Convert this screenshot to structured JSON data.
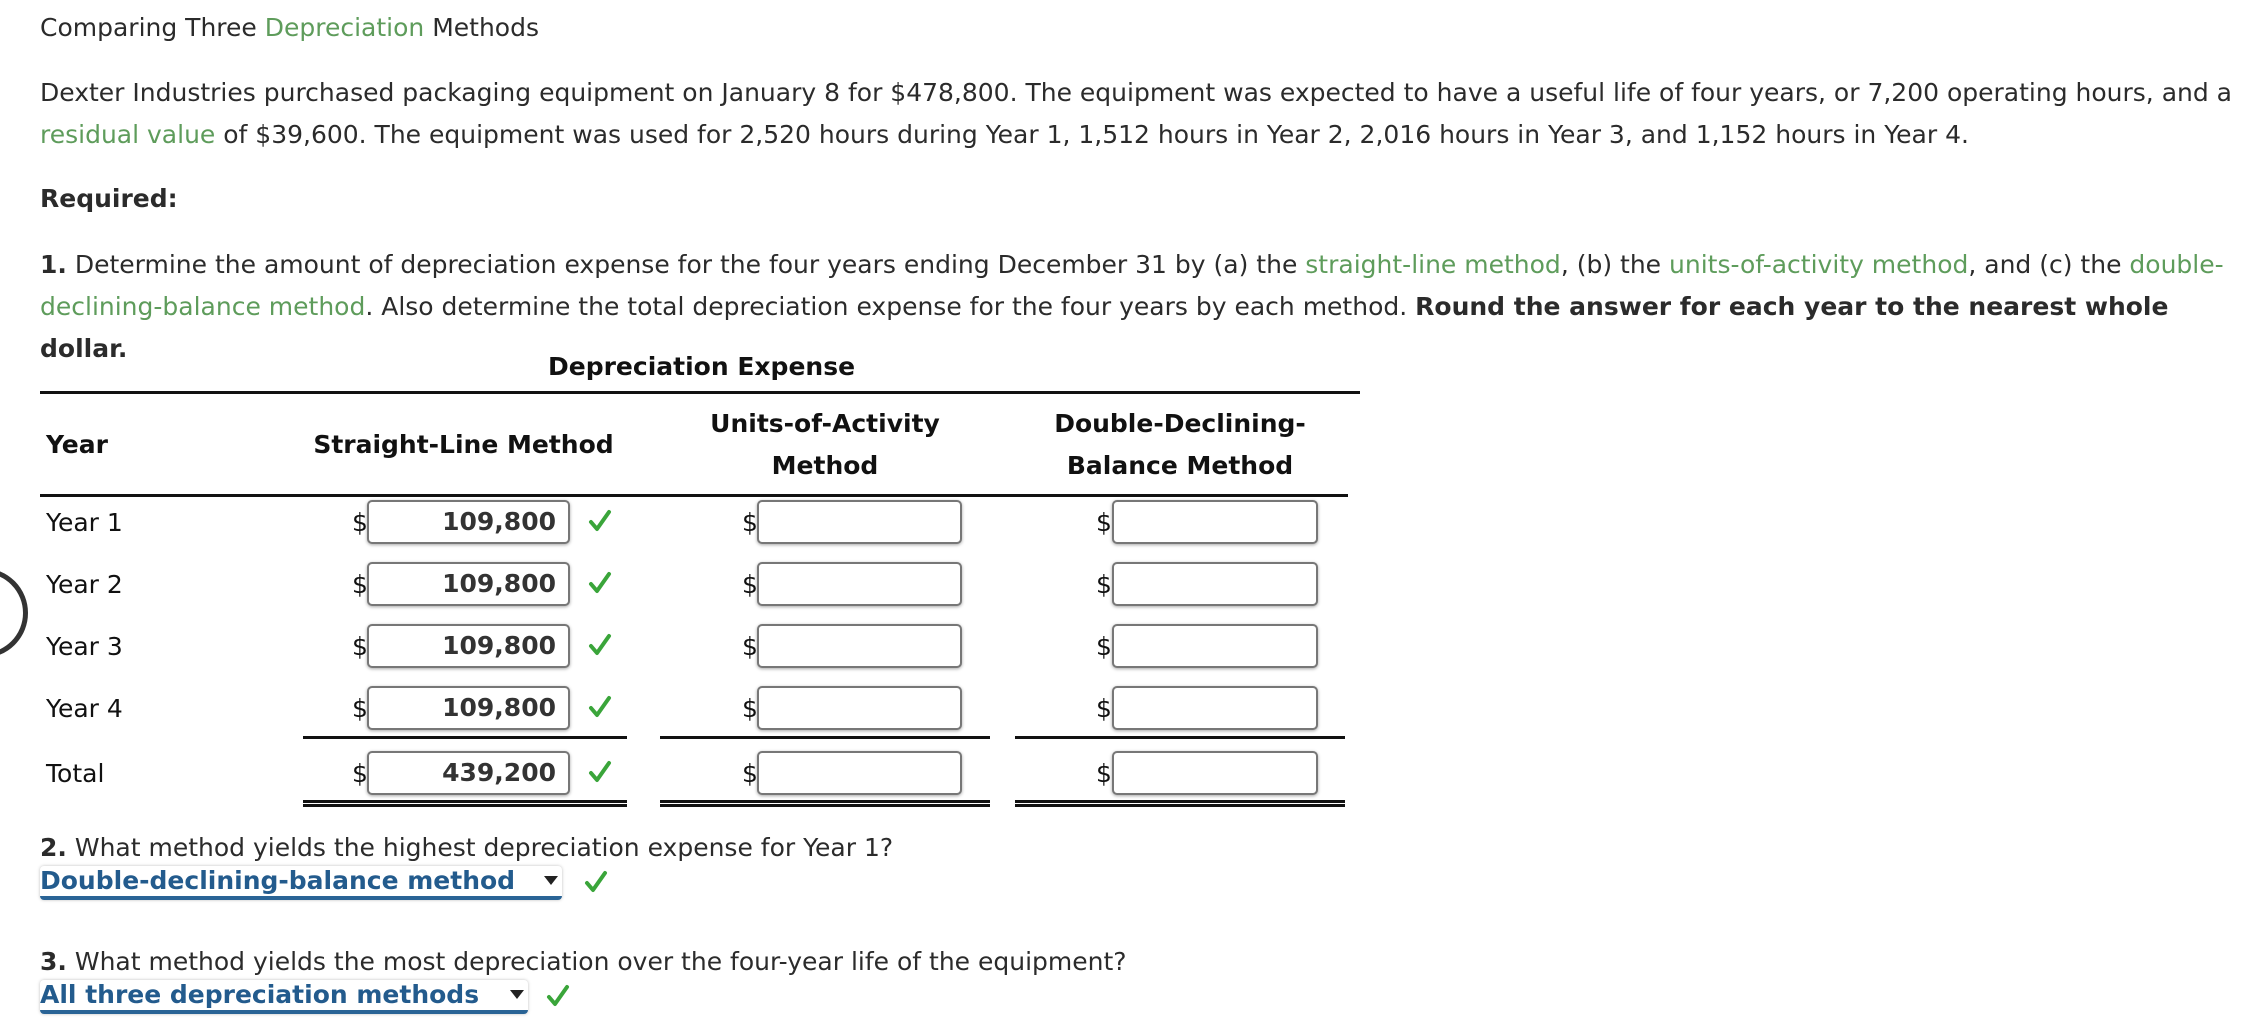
{
  "title": {
    "prefix": "Comparing Three ",
    "link": "Depreciation",
    "suffix": " Methods"
  },
  "problem": {
    "text_before": "Dexter Industries purchased packaging equipment on January 8 for $478,800. The equipment was expected to have a useful life of four years, or 7,200 operating hours, and a ",
    "link": "residual value",
    "text_after": " of $39,600. The equipment was used for 2,520 hours during Year 1, 1,512 hours in Year 2, 2,016 hours in Year 3, and 1,152 hours in Year 4."
  },
  "required_label": "Required:",
  "question1": {
    "number": "1.",
    "t1": " Determine the amount of depreciation expense for the four years ending December 31 by (a) the ",
    "link_sl": "straight-line method",
    "t2": ", (b) the ",
    "link_uoa": "units-of-activity method",
    "t3": ", and (c) the ",
    "link_ddb": "double-declining-balance method",
    "t4": ". Also determine the total depreciation expense for the four years by each method. ",
    "bold": "Round the answer for each year to the nearest whole dollar."
  },
  "table": {
    "caption": "Depreciation Expense",
    "headers": {
      "year": "Year",
      "sl": "Straight-Line Method",
      "uoa_line1": "Units-of-Activity",
      "uoa_line2": "Method",
      "ddb_line1": "Double-Declining-",
      "ddb_line2": "Balance Method"
    },
    "currency": "$",
    "rows": [
      {
        "label": "Year 1",
        "sl": "109,800",
        "sl_correct": true,
        "uoa": "",
        "ddb": ""
      },
      {
        "label": "Year 2",
        "sl": "109,800",
        "sl_correct": true,
        "uoa": "",
        "ddb": ""
      },
      {
        "label": "Year 3",
        "sl": "109,800",
        "sl_correct": true,
        "uoa": "",
        "ddb": ""
      },
      {
        "label": "Year 4",
        "sl": "109,800",
        "sl_correct": true,
        "uoa": "",
        "ddb": ""
      },
      {
        "label": "Total",
        "sl": "439,200",
        "sl_correct": true,
        "uoa": "",
        "ddb": ""
      }
    ]
  },
  "question2": {
    "number": "2.",
    "text": " What method yields the highest depreciation expense for Year 1?",
    "selected": "Double-declining-balance method",
    "correct": true
  },
  "question3": {
    "number": "3.",
    "text": " What method yields the most depreciation over the four-year life of the equipment?",
    "selected": "All three depreciation methods",
    "correct": true
  },
  "colors": {
    "link_green": "#5e9c5b",
    "check_green": "#3aa53a",
    "select_blue": "#235b8d"
  }
}
